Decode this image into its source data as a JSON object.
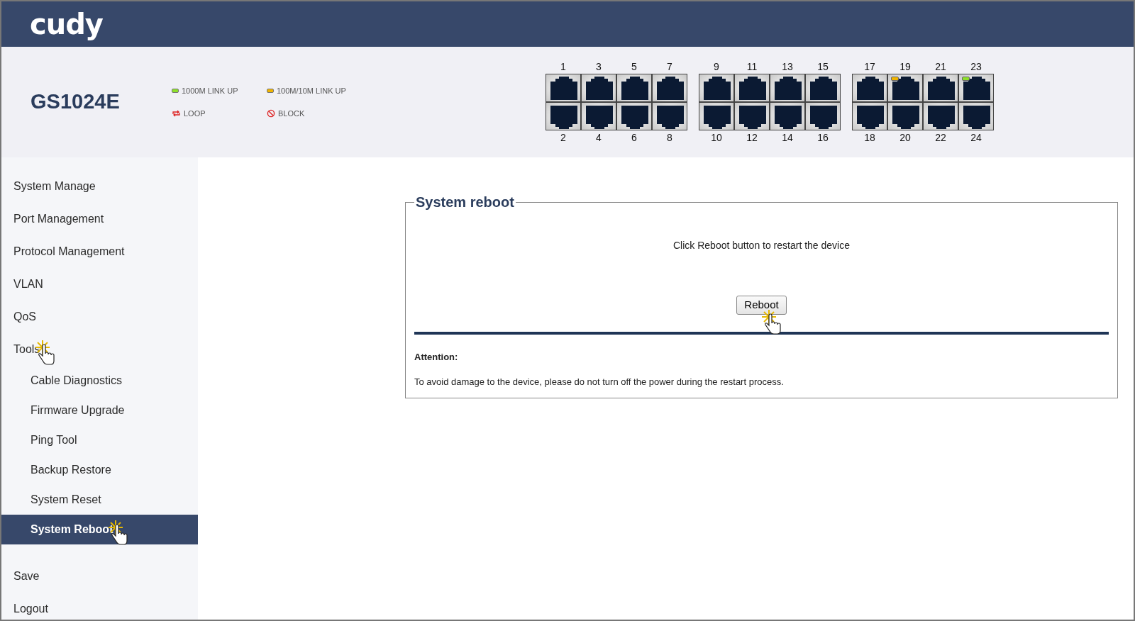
{
  "header": {
    "logo": "cudy"
  },
  "device": {
    "model": "GS1024E",
    "legend": [
      {
        "kind": "led",
        "color": "#8ee02a",
        "label": "1000M LINK UP"
      },
      {
        "kind": "led",
        "color": "#f0b400",
        "label": "100M/10M LINK UP"
      },
      {
        "kind": "loop",
        "label": "LOOP"
      },
      {
        "kind": "block",
        "label": "BLOCK"
      }
    ],
    "port_groups": [
      {
        "columns": [
          {
            "top": {
              "number": "1",
              "led_on": false
            },
            "bottom": {
              "number": "2",
              "led_on": false
            }
          },
          {
            "top": {
              "number": "3",
              "led_on": false
            },
            "bottom": {
              "number": "4",
              "led_on": false
            }
          },
          {
            "top": {
              "number": "5",
              "led_on": false
            },
            "bottom": {
              "number": "6",
              "led_on": false
            }
          },
          {
            "top": {
              "number": "7",
              "led_on": false
            },
            "bottom": {
              "number": "8",
              "led_on": false
            }
          }
        ]
      },
      {
        "columns": [
          {
            "top": {
              "number": "9",
              "led_on": false
            },
            "bottom": {
              "number": "10",
              "led_on": false
            }
          },
          {
            "top": {
              "number": "11",
              "led_on": false
            },
            "bottom": {
              "number": "12",
              "led_on": false
            }
          },
          {
            "top": {
              "number": "13",
              "led_on": false
            },
            "bottom": {
              "number": "14",
              "led_on": false
            }
          },
          {
            "top": {
              "number": "15",
              "led_on": false
            },
            "bottom": {
              "number": "16",
              "led_on": false
            }
          }
        ]
      },
      {
        "columns": [
          {
            "top": {
              "number": "17",
              "led_on": false
            },
            "bottom": {
              "number": "18",
              "led_on": false
            }
          },
          {
            "top": {
              "number": "19",
              "led_on": true,
              "color": "#f0b400"
            },
            "bottom": {
              "number": "20",
              "led_on": false
            }
          },
          {
            "top": {
              "number": "21",
              "led_on": false
            },
            "bottom": {
              "number": "22",
              "led_on": false
            }
          },
          {
            "top": {
              "number": "23",
              "led_on": true,
              "color": "#8ee02a"
            },
            "bottom": {
              "number": "24",
              "led_on": false
            }
          }
        ]
      }
    ]
  },
  "sidebar": {
    "items": [
      {
        "label": "System Manage",
        "selected": false,
        "clicked": false
      },
      {
        "label": "Port Management",
        "selected": false,
        "clicked": false
      },
      {
        "label": "Protocol Management",
        "selected": false,
        "clicked": false
      },
      {
        "label": "VLAN",
        "selected": false,
        "clicked": false
      },
      {
        "label": "QoS",
        "selected": false,
        "clicked": false
      },
      {
        "label": "Tools",
        "selected": false,
        "clicked": true,
        "children": [
          {
            "label": "Cable Diagnostics",
            "selected": false,
            "clicked": false
          },
          {
            "label": "Firmware Upgrade",
            "selected": false,
            "clicked": false
          },
          {
            "label": "Ping Tool",
            "selected": false,
            "clicked": false
          },
          {
            "label": "Backup Restore",
            "selected": false,
            "clicked": false
          },
          {
            "label": "System Reset",
            "selected": false,
            "clicked": false
          },
          {
            "label": "System Reboot",
            "selected": true,
            "clicked": true
          }
        ]
      }
    ],
    "actions": [
      {
        "label": "Save"
      },
      {
        "label": "Logout"
      }
    ]
  },
  "panel": {
    "title": "System reboot",
    "instruction": "Click Reboot button to restart the device",
    "button": {
      "label": "Reboot",
      "clicked": true
    },
    "attention_title": "Attention:",
    "attention_text": "To avoid damage to the device, please do not turn off the power during the restart process."
  }
}
